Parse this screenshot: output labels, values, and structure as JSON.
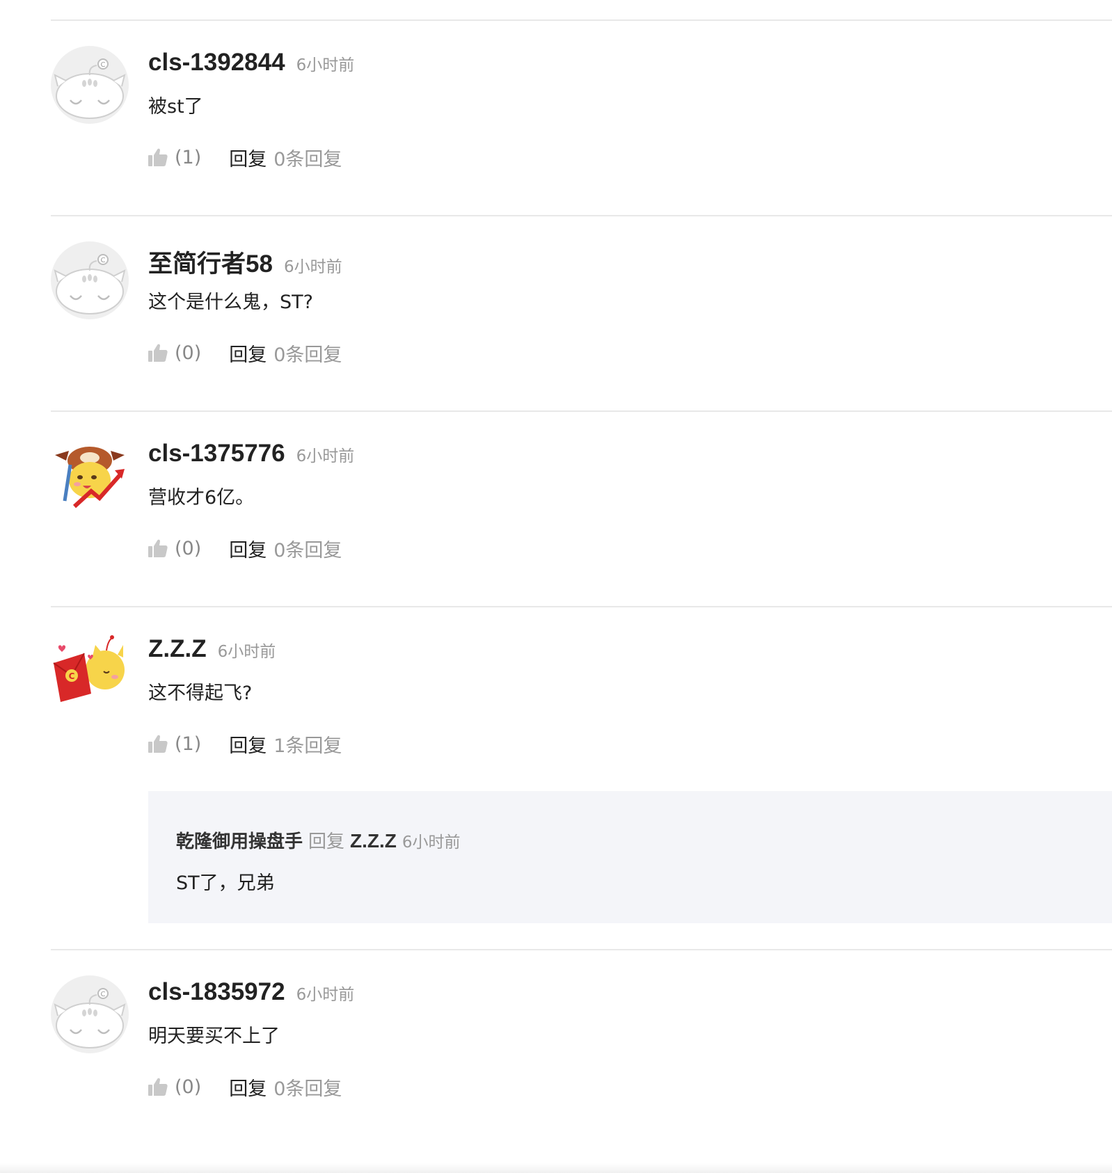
{
  "comments": [
    {
      "avatar": "default-cat-avatar",
      "username": "cls-1392844",
      "time": "6小时前",
      "text": "被st了",
      "likes": "(1)",
      "reply_label": "回复",
      "reply_count": "0条回复"
    },
    {
      "avatar": "default-cat-avatar",
      "username": "至简行者58",
      "time": "6小时前",
      "text": "这个是什么鬼，ST?",
      "likes": "(0)",
      "reply_label": "回复",
      "reply_count": "0条回复"
    },
    {
      "avatar": "bull-cat-avatar",
      "username": "cls-1375776",
      "time": "6小时前",
      "text": "营收才6亿。",
      "likes": "(0)",
      "reply_label": "回复",
      "reply_count": "0条回复"
    },
    {
      "avatar": "red-envelope-cat-avatar",
      "username": "Z.Z.Z",
      "time": "6小时前",
      "text": "这不得起飞?",
      "likes": "(1)",
      "reply_label": "回复",
      "reply_count": "1条回复",
      "subreply": {
        "username": "乾隆御用操盘手",
        "reply_word": "回复",
        "target": "Z.Z.Z",
        "time": "6小时前",
        "text": "ST了，兄弟"
      }
    },
    {
      "avatar": "default-cat-avatar",
      "username": "cls-1835972",
      "time": "6小时前",
      "text": "明天要买不上了",
      "likes": "(0)",
      "reply_label": "回复",
      "reply_count": "0条回复"
    }
  ],
  "icons": {
    "like": "thumbs-up-icon"
  },
  "colors": {
    "username": "#222222",
    "muted": "#999999",
    "divider": "#e8e8e8",
    "subreply_bg": "#f4f5f9"
  }
}
